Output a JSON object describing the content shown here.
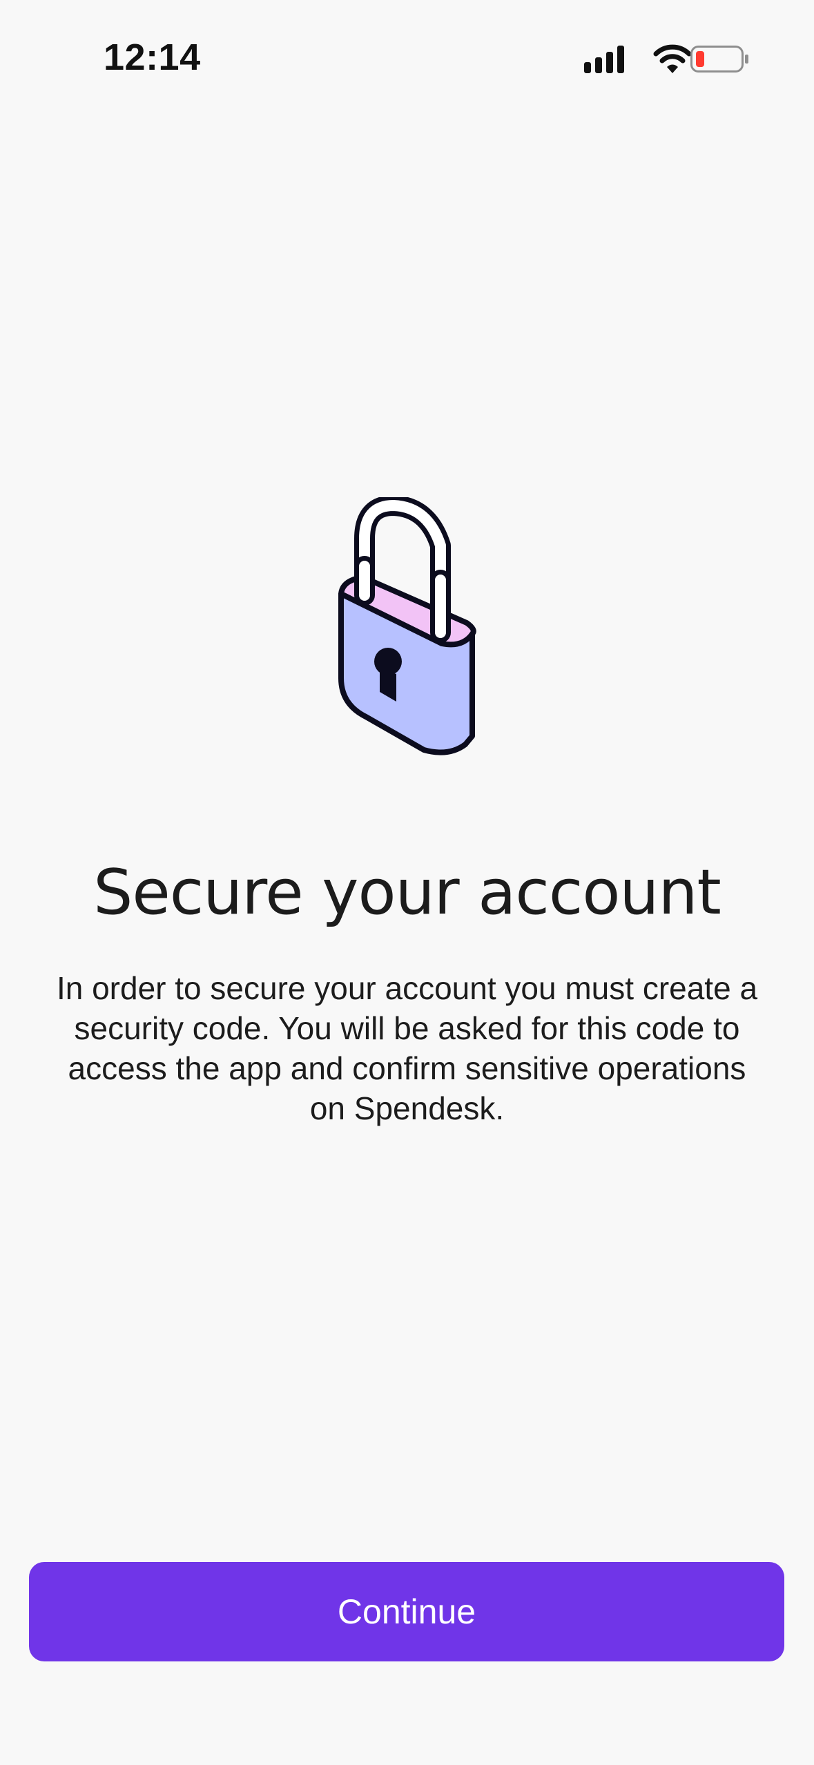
{
  "status_bar": {
    "time": "12:14",
    "icons": [
      "cellular-signal-icon",
      "wifi-icon",
      "battery-low-icon"
    ],
    "battery_color": "#ff3b30"
  },
  "illustration": {
    "icon": "padlock-icon",
    "colors": {
      "body": "#b7c1ff",
      "top": "#f2c3f6",
      "outline": "#0c0c1e"
    }
  },
  "onboarding": {
    "title": "Secure your account",
    "description": "In order to secure your account you must create a security code. You will be asked for this code to access the app and confirm sensitive operations on Spendesk."
  },
  "actions": {
    "continue_label": "Continue"
  },
  "theme": {
    "accent": "#7035e8",
    "background": "#f8f8f8",
    "text": "#1c1c1c"
  }
}
